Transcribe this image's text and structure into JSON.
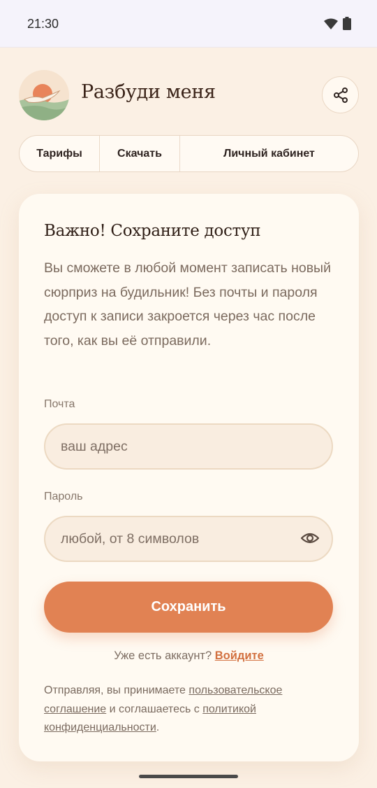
{
  "status_bar": {
    "time": "21:30"
  },
  "header": {
    "title": "Разбуди меня"
  },
  "nav": {
    "items": [
      {
        "label": "Тарифы"
      },
      {
        "label": "Скачать"
      },
      {
        "label": "Личный кабинет"
      }
    ]
  },
  "card": {
    "title": "Важно! Сохраните доступ",
    "description": "Вы сможете в любой момент записать новый сюрприз на будильник! Без почты и пароля доступ к записи закроется через час после того, как вы её отправили.",
    "email": {
      "label": "Почта",
      "placeholder": "ваш адрес",
      "value": ""
    },
    "password": {
      "label": "Пароль",
      "placeholder": "любой, от 8 символов",
      "value": ""
    },
    "save_button": "Сохранить",
    "login_prompt": "Уже есть аккаунт?",
    "login_link": "Войдите",
    "legal": {
      "prefix": "Отправляя, вы принимаете ",
      "terms_link": "пользовательское соглашение",
      "middle": " и соглашаетесь с ",
      "privacy_link": "политикой конфиденциальности",
      "suffix": "."
    }
  },
  "colors": {
    "accent": "#e18253",
    "background": "#fbf0e4",
    "card": "#fffaf2",
    "link": "#d2703f"
  },
  "icons": [
    "wifi-icon",
    "battery-icon",
    "share-icon",
    "eye-icon"
  ]
}
